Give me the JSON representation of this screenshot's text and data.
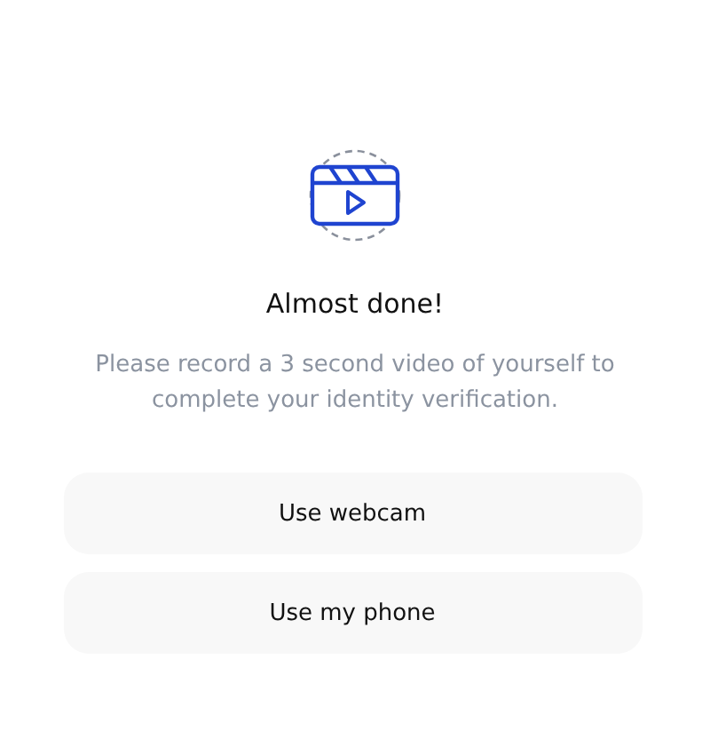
{
  "title": "Almost done!",
  "description": "Please record a 3 second video of yourself to complete your identity verification.",
  "buttons": [
    {
      "label": "Use webcam"
    },
    {
      "label": "Use my phone"
    }
  ]
}
